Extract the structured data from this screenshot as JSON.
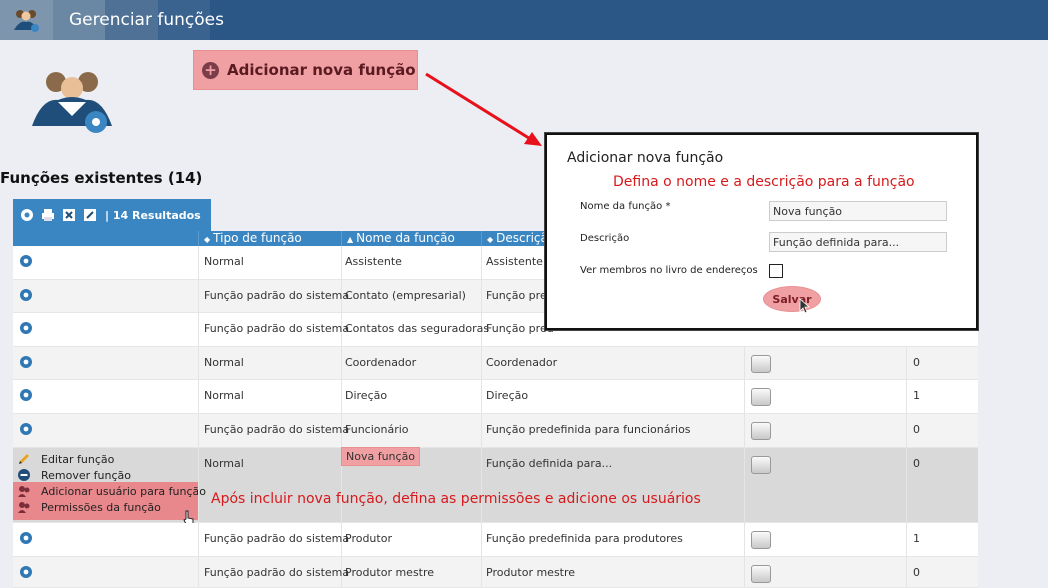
{
  "topbar": {
    "title": "Gerenciar funções"
  },
  "add_button": {
    "label": "Adicionar nova função"
  },
  "section": {
    "title": "Funções existentes (14)"
  },
  "toolbar": {
    "results": "| 14 Resultados"
  },
  "table": {
    "headers": [
      "Tipo de função",
      "Nome da função",
      "Descriçã"
    ],
    "rows": [
      {
        "tipo": "Normal",
        "nome": "Assistente",
        "descricao": "Assistente",
        "membros": ""
      },
      {
        "tipo": "Função padrão do sistema",
        "nome": "Contato (empresarial)",
        "descricao": "Função pred",
        "membros": ""
      },
      {
        "tipo": "Função padrão do sistema",
        "nome": "Contatos das seguradoras",
        "descricao": "Função pred",
        "membros": ""
      },
      {
        "tipo": "Normal",
        "nome": "Coordenador",
        "descricao": "Coordenador",
        "membros": "0"
      },
      {
        "tipo": "Normal",
        "nome": "Direção",
        "descricao": "Direção",
        "membros": "1"
      },
      {
        "tipo": "Função padrão do sistema",
        "nome": "Funcionário",
        "descricao": "Função predefinida para funcionários",
        "membros": "0"
      },
      {
        "tipo": "Normal",
        "nome": "Nova função",
        "descricao": "Função definida para...",
        "membros": "0"
      },
      {
        "tipo": "Função padrão do sistema",
        "nome": "Produtor",
        "descricao": "Função predefinida para produtores",
        "membros": "1"
      },
      {
        "tipo": "Função padrão do sistema",
        "nome": "Produtor mestre",
        "descricao": "Produtor mestre",
        "membros": "0"
      }
    ]
  },
  "context_menu": {
    "edit": "Editar função",
    "remove": "Remover função",
    "add_user": "Adicionar usuário para função",
    "permissions": "Permissões da função"
  },
  "annotations": {
    "after_add": "Após incluir nova função, defina as permissões e adicione os usuários",
    "dialog_hint": "Defina o nome e a descrição para a função"
  },
  "dialog": {
    "title": "Adicionar nova função",
    "name_label": "Nome da função *",
    "name_value": "Nova função",
    "desc_label": "Descrição",
    "desc_value": "Função definida para...",
    "members_label": "Ver membros no livro de endereços",
    "save_label": "Salvar"
  },
  "colors": {
    "topbar": "#2b5786",
    "table_header": "#3a86c2",
    "highlight": "#f0a0a2",
    "annotation": "#d7191c"
  }
}
